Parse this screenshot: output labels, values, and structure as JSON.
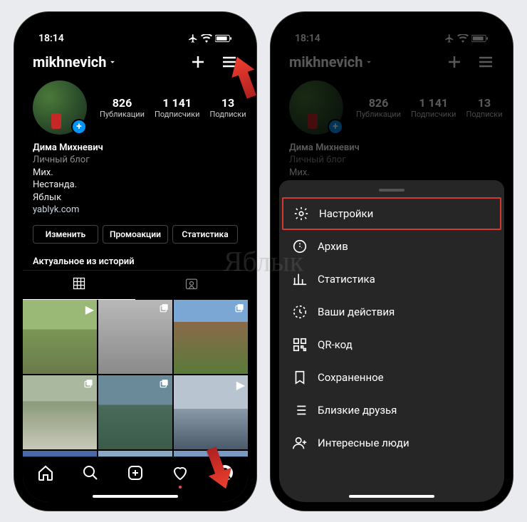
{
  "status": {
    "time": "18:14"
  },
  "header": {
    "username": "mikhnevich"
  },
  "stats": {
    "posts": {
      "num": "826",
      "label": "Публикации"
    },
    "followers": {
      "num": "1 141",
      "label": "Подписчики"
    },
    "following": {
      "num": "13",
      "label": "Подписки"
    }
  },
  "bio": {
    "name": "Дима Михневич",
    "category": "Личный блог",
    "line1": "Мих.",
    "line2": "Нестанда.",
    "line3": "Яблык",
    "link": "yablyk.com"
  },
  "buttons": {
    "edit": "Изменить",
    "promo": "Промоакции",
    "insights": "Статистика"
  },
  "highlights_title": "Актуальное из историй",
  "sheet": {
    "settings": "Настройки",
    "archive": "Архив",
    "stats": "Статистика",
    "activity": "Ваши действия",
    "qr": "QR-код",
    "saved": "Сохраненное",
    "close_friends": "Близкие друзья",
    "discover": "Интересные люди"
  },
  "watermark": "Яблык"
}
